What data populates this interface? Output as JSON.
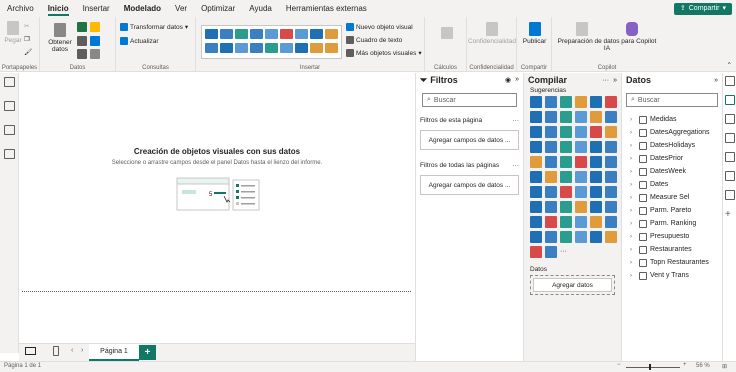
{
  "menu": [
    "Archivo",
    "Inicio",
    "Insertar",
    "Modelado",
    "Ver",
    "Optimizar",
    "Ayuda",
    "Herramientas externas"
  ],
  "share_label": "Compartir",
  "ribbon": {
    "paste": "Pegar",
    "clipboard_group": "Portapapeles",
    "get_data": "Obtener datos",
    "data_group": "Datos",
    "transform": "Transformar datos",
    "refresh": "Actualizar",
    "queries_group": "Consultas",
    "new_visual": "Nuevo objeto visual",
    "textbox": "Cuadro de texto",
    "more_visuals": "Más objetos visuales",
    "insert_group": "Insertar",
    "calc_group": "Cálculos",
    "sensitivity": "Confidencialidad",
    "conf_group": "Confidencialidad",
    "publish": "Publicar",
    "share_group": "Compartir",
    "copilot_prep": "Preparación de datos para Copilot IA",
    "copilot_group": "Copilot"
  },
  "canvas": {
    "title": "Creación de objetos visuales con sus datos",
    "subtitle": "Seleccione o arrastre campos desde el panel Datos hasta el lienzo del informe."
  },
  "pages": {
    "current": "Página 1",
    "add": "+"
  },
  "status": {
    "page_info": "Página 1 de 1",
    "zoom": "56 %"
  },
  "filters": {
    "title": "Filtros",
    "search": "Buscar",
    "this_page": "Filtros de esta página",
    "all_pages": "Filtros de todas las páginas",
    "add_fields": "Agregar campos de datos ..."
  },
  "build": {
    "title": "Compilar",
    "suggestions": "Sugerencias",
    "data_label": "Datos",
    "add_data": "Agregar datos",
    "more": "···"
  },
  "data_panel": {
    "title": "Datos",
    "search": "Buscar",
    "items": [
      "Medidas",
      "DatesAggregations",
      "DatesHolidays",
      "DatesPrior",
      "DatesWeek",
      "Dates",
      "Measure Sel",
      "Parm. Pareto",
      "Parm. Ranking",
      "Presupuesto",
      "Restaurantes",
      "Topn Restaurantes",
      "Vent y Trans"
    ]
  },
  "colors": {
    "accent": "#117865",
    "chrome": "#f3f2f1"
  }
}
